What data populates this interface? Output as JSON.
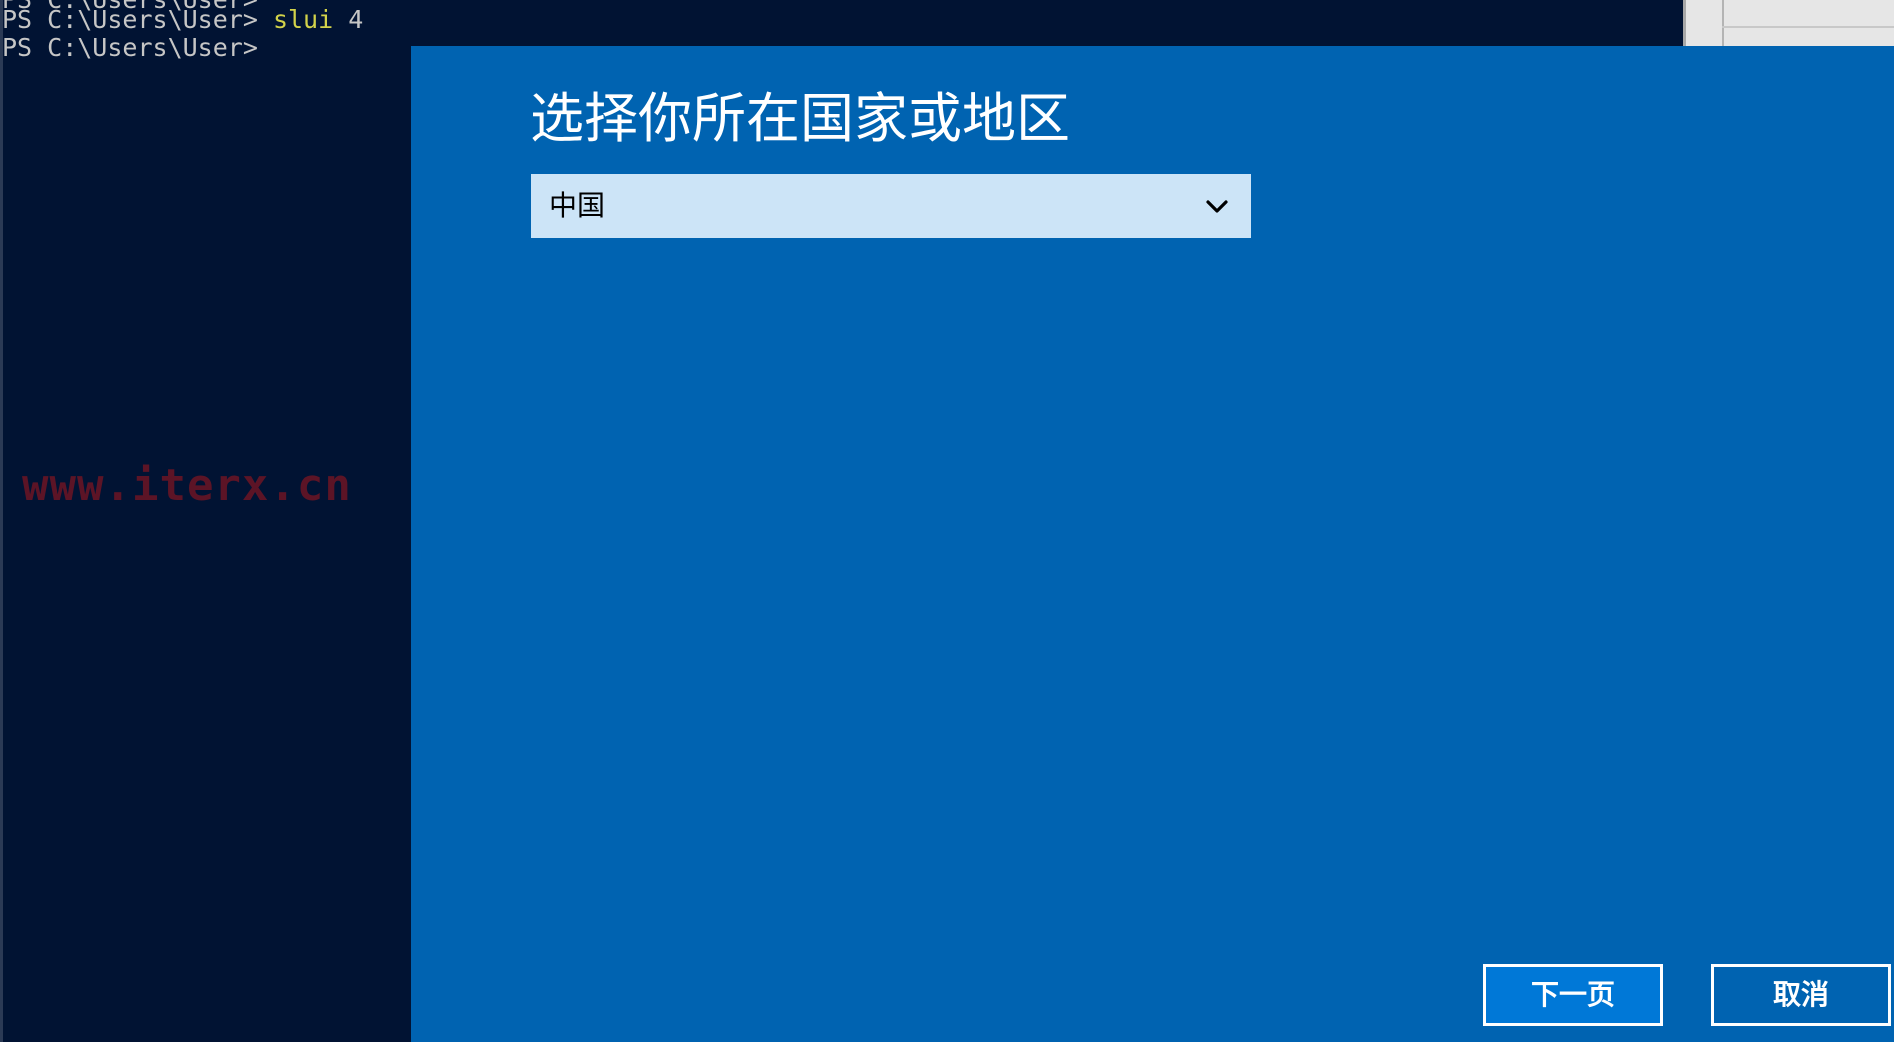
{
  "terminal": {
    "lines": [
      {
        "prompt": "PS C:\\Users\\User>",
        "command": "slui",
        "arg": "4"
      },
      {
        "prompt": "PS C:\\Users\\User>"
      }
    ],
    "colors": {
      "background": "#011333",
      "text": "#c6c6c6",
      "command": "#d2d24a"
    }
  },
  "watermark": {
    "text": "www.iterx.cn",
    "color": "#5c1426"
  },
  "dialog": {
    "title": "选择你所在国家或地区",
    "country_select": {
      "selected": "中国",
      "icon": "chevron-down-icon"
    },
    "buttons": {
      "next_label": "下一页",
      "cancel_label": "取消"
    },
    "colors": {
      "background": "#0063b1",
      "select_background": "#cce4f7",
      "primary_button": "#0078d7"
    }
  }
}
